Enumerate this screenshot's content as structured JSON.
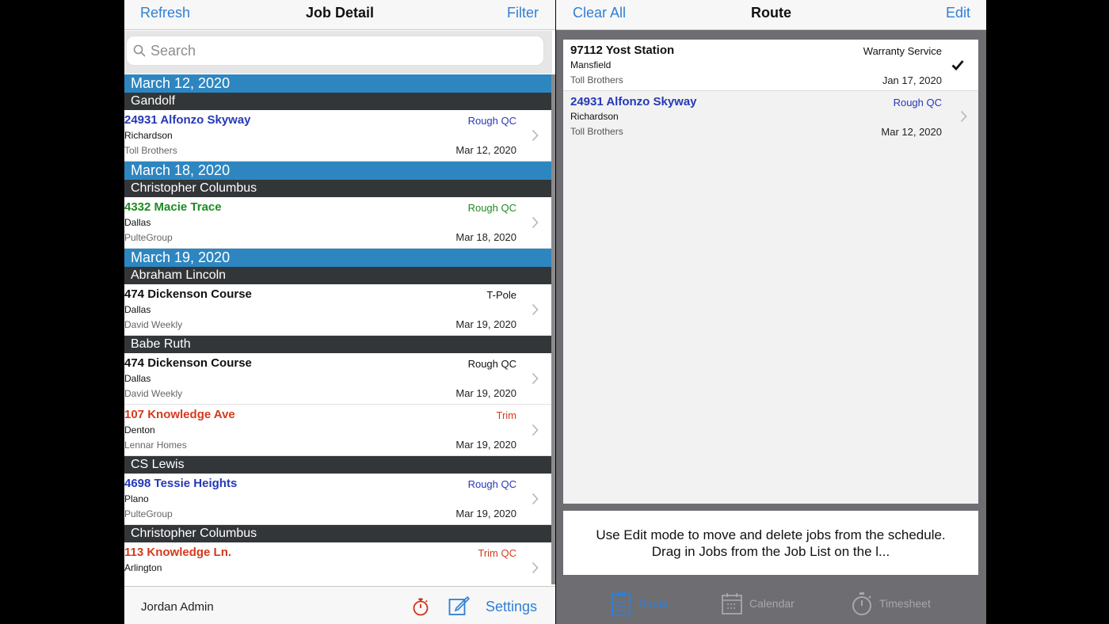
{
  "left": {
    "nav": {
      "refresh": "Refresh",
      "title": "Job Detail",
      "filter": "Filter"
    },
    "search": {
      "placeholder": "Search"
    },
    "groups": [
      {
        "date": "March 12, 2020",
        "people": [
          {
            "name": "Gandolf",
            "jobs": [
              {
                "address": "24931 Alfonzo Skyway",
                "type": "Rough QC",
                "city": "Richardson",
                "builder": "Toll Brothers",
                "date": "Mar 12, 2020",
                "color": "#2638b8"
              }
            ]
          }
        ]
      },
      {
        "date": "March 18, 2020",
        "people": [
          {
            "name": "Christopher Columbus",
            "jobs": [
              {
                "address": "4332 Macie Trace",
                "type": "Rough QC",
                "city": "Dallas",
                "builder": "PulteGroup",
                "date": "Mar 18, 2020",
                "color": "#1f8a22"
              }
            ]
          }
        ]
      },
      {
        "date": "March 19, 2020",
        "people": [
          {
            "name": "Abraham Lincoln",
            "jobs": [
              {
                "address": "474 Dickenson Course",
                "type": "T-Pole",
                "city": "Dallas",
                "builder": "David Weekly",
                "date": "Mar 19, 2020",
                "color": "#111111"
              }
            ]
          },
          {
            "name": "Babe Ruth",
            "jobs": [
              {
                "address": "474 Dickenson Course",
                "type": "Rough QC",
                "city": "Dallas",
                "builder": "David Weekly",
                "date": "Mar 19, 2020",
                "color": "#111111"
              },
              {
                "address": "107 Knowledge Ave",
                "type": "Trim",
                "city": "Denton",
                "builder": "Lennar Homes",
                "date": "Mar 19, 2020",
                "color": "#d63a1e"
              }
            ]
          },
          {
            "name": "CS Lewis",
            "jobs": [
              {
                "address": "4698 Tessie Heights",
                "type": "Rough QC",
                "city": "Plano",
                "builder": "PulteGroup",
                "date": "Mar 19, 2020",
                "color": "#2638b8"
              }
            ]
          },
          {
            "name": "Christopher Columbus",
            "jobs": [
              {
                "address": "113 Knowledge Ln.",
                "type": "Trim QC",
                "city": "Arlington",
                "builder": "",
                "date": "",
                "color": "#d63a1e"
              }
            ]
          }
        ]
      }
    ],
    "bottom": {
      "user": "Jordan Admin",
      "settings": "Settings"
    }
  },
  "right": {
    "nav": {
      "clear_all": "Clear All",
      "title": "Route",
      "edit": "Edit"
    },
    "route_jobs": [
      {
        "address": "97112 Yost Station",
        "type": "Warranty Service",
        "city": "Mansfield",
        "builder": "Toll Brothers",
        "date": "Jan 17, 2020",
        "color": "#111111",
        "done": true
      },
      {
        "address": "24931 Alfonzo Skyway",
        "type": "Rough QC",
        "city": "Richardson",
        "builder": "Toll Brothers",
        "date": "Mar 12, 2020",
        "color": "#2638b8",
        "done": false
      }
    ],
    "help_text": "Use Edit mode to move and delete jobs from the schedule. Drag in Jobs from the Job List on the l...",
    "tabs": [
      {
        "label": "Route",
        "icon": "clipboard-icon",
        "active": true
      },
      {
        "label": "Calendar",
        "icon": "calendar-icon",
        "active": false
      },
      {
        "label": "Timesheet",
        "icon": "stopwatch-icon",
        "active": false
      }
    ]
  }
}
